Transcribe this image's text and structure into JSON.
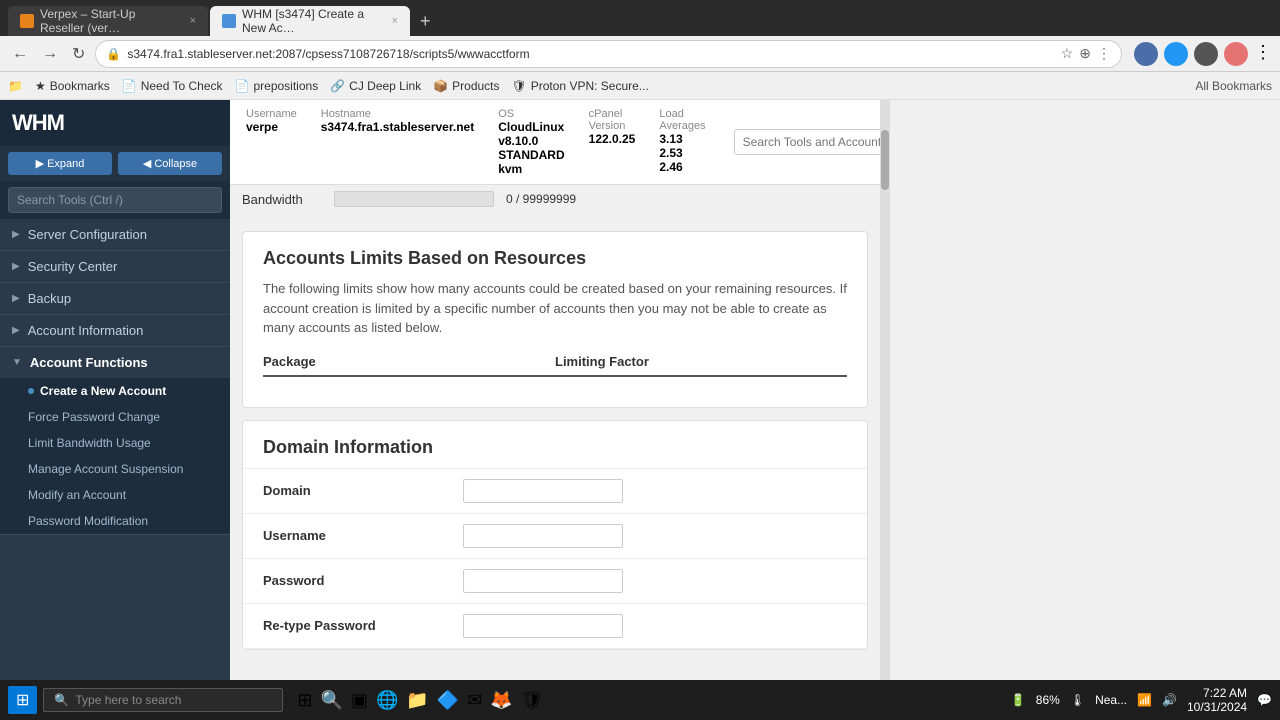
{
  "browser": {
    "tabs": [
      {
        "id": "tab1",
        "label": "Verpex – Start-Up Reseller (ver…",
        "favicon": "orange",
        "active": false,
        "close": "×"
      },
      {
        "id": "tab2",
        "label": "WHM [s3474] Create a New Ac…",
        "favicon": "blue",
        "active": true,
        "close": "×"
      }
    ],
    "new_tab_label": "+",
    "address": "s3474.fra1.stableserver.net:2087/cpsess7108726718/scripts5/wwwacctform",
    "bookmarks": [
      {
        "id": "bk1",
        "icon": "★",
        "label": "Bookmarks"
      },
      {
        "id": "bk2",
        "icon": "📄",
        "label": "Need To Check"
      },
      {
        "id": "bk3",
        "icon": "📄",
        "label": "prepositions"
      },
      {
        "id": "bk4",
        "icon": "🔗",
        "label": "CJ Deep Link"
      },
      {
        "id": "bk5",
        "icon": "📦",
        "label": "Products"
      },
      {
        "id": "bk6",
        "icon": "🛡",
        "label": "Proton VPN: Secure..."
      }
    ],
    "all_bookmarks": "All Bookmarks"
  },
  "info_bar": {
    "username_label": "Username",
    "username_val": "verpe",
    "hostname_label": "Hostname",
    "hostname_val": "s3474.fra1.stableserver.net",
    "os_label": "OS",
    "os_val": "CloudLinux v8.10.0 STANDARD kvm",
    "cpanel_label": "cPanel Version",
    "cpanel_val": "122.0.25",
    "load_label": "Load Averages",
    "load_val": "3.13  2.53  2.46"
  },
  "sidebar": {
    "logo": "WHM",
    "expand_btn": "▶ Expand",
    "collapse_btn": "◀ Collapse",
    "search_placeholder": "Search Tools (Ctrl /)",
    "nav": [
      {
        "id": "server-config",
        "label": "Server Configuration",
        "expanded": false
      },
      {
        "id": "security-center",
        "label": "Security Center",
        "expanded": false
      },
      {
        "id": "backup",
        "label": "Backup",
        "expanded": false
      },
      {
        "id": "account-info",
        "label": "Account Information",
        "expanded": false
      },
      {
        "id": "account-functions",
        "label": "Account Functions",
        "expanded": true,
        "children": [
          {
            "id": "create-account",
            "label": "Create a New Account",
            "active": true
          },
          {
            "id": "force-password",
            "label": "Force Password Change"
          },
          {
            "id": "limit-bandwidth",
            "label": "Limit Bandwidth Usage"
          },
          {
            "id": "manage-suspension",
            "label": "Manage Account Suspension"
          },
          {
            "id": "modify-account",
            "label": "Modify an Account"
          },
          {
            "id": "password-modification",
            "label": "Password Modification"
          }
        ]
      }
    ]
  },
  "header": {
    "search_placeholder": "Search Tools and Accounts (/)"
  },
  "bandwidth": {
    "label": "Bandwidth",
    "value": "0 / 99999999",
    "progress_pct": 0
  },
  "account_limits": {
    "title": "Accounts Limits Based on Resources",
    "description": "The following limits show how many accounts could be created based on your remaining resources. If account creation is limited by a specific number of accounts then you may not be able to create as many accounts as listed below.",
    "col1": "Package",
    "col2": "Limiting Factor"
  },
  "domain_info": {
    "title": "Domain Information",
    "fields": [
      {
        "id": "domain",
        "label": "Domain",
        "placeholder": ""
      },
      {
        "id": "username",
        "label": "Username",
        "placeholder": ""
      },
      {
        "id": "password",
        "label": "Password",
        "placeholder": ""
      },
      {
        "id": "retype-password",
        "label": "Re-type Password",
        "placeholder": ""
      }
    ]
  },
  "taskbar": {
    "time": "7:22 AM",
    "date": "10/31/2024",
    "battery": "86%",
    "search_placeholder": "Type here to search"
  }
}
